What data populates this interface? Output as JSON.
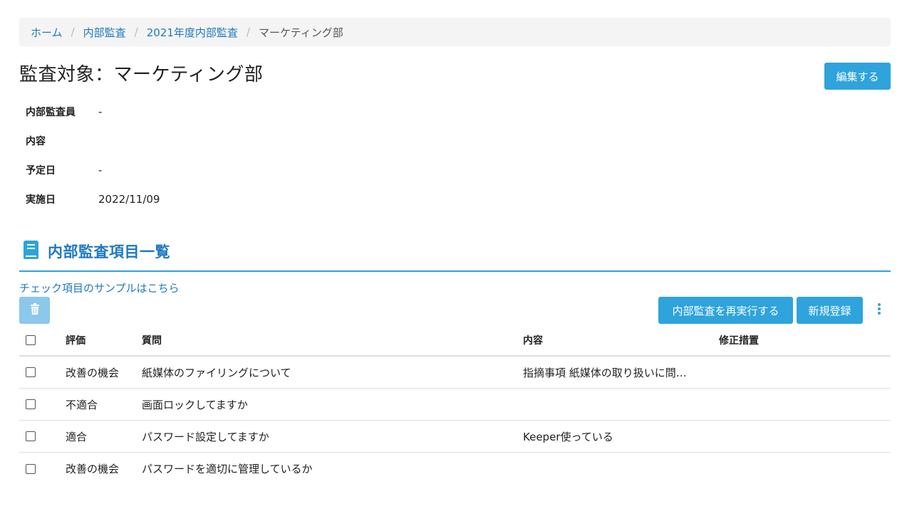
{
  "breadcrumb": {
    "items": [
      "ホーム",
      "内部監査",
      "2021年度内部監査"
    ],
    "current": "マーケティング部",
    "separator": "/"
  },
  "page": {
    "title": "監査対象：マーケティング部",
    "edit_label": "編集する"
  },
  "info": [
    {
      "label": "内部監査員",
      "value": "-"
    },
    {
      "label": "内容",
      "value": ""
    },
    {
      "label": "予定日",
      "value": "-"
    },
    {
      "label": "実施日",
      "value": "2022/11/09"
    }
  ],
  "section": {
    "title": "内部監査項目一覧",
    "icon": "book-icon",
    "sample_link": "チェック項目のサンプルはこちら"
  },
  "toolbar": {
    "delete_icon": "trash-icon",
    "rerun_label": "内部監査を再実行する",
    "new_label": "新規登録",
    "more_icon": "vertical-dots-icon"
  },
  "table": {
    "headers": {
      "eval": "評価",
      "question": "質問",
      "content": "内容",
      "fix": "修正措置"
    },
    "rows": [
      {
        "eval": "改善の機会",
        "question": "紙媒体のファイリングについて",
        "content": "指摘事項 紙媒体の取り扱いに問…",
        "fix": ""
      },
      {
        "eval": "不適合",
        "question": "画面ロックしてますか",
        "content": "",
        "fix": ""
      },
      {
        "eval": "適合",
        "question": "パスワード設定してますか",
        "content": "Keeper使っている",
        "fix": ""
      },
      {
        "eval": "改善の機会",
        "question": "パスワードを適切に管理しているか",
        "content": "",
        "fix": ""
      }
    ]
  },
  "colors": {
    "accent": "#2ea3dc",
    "link": "#1f78c1",
    "disabled_button": "#8cc8eb",
    "breadcrumb_bg": "#f4f4f4"
  }
}
